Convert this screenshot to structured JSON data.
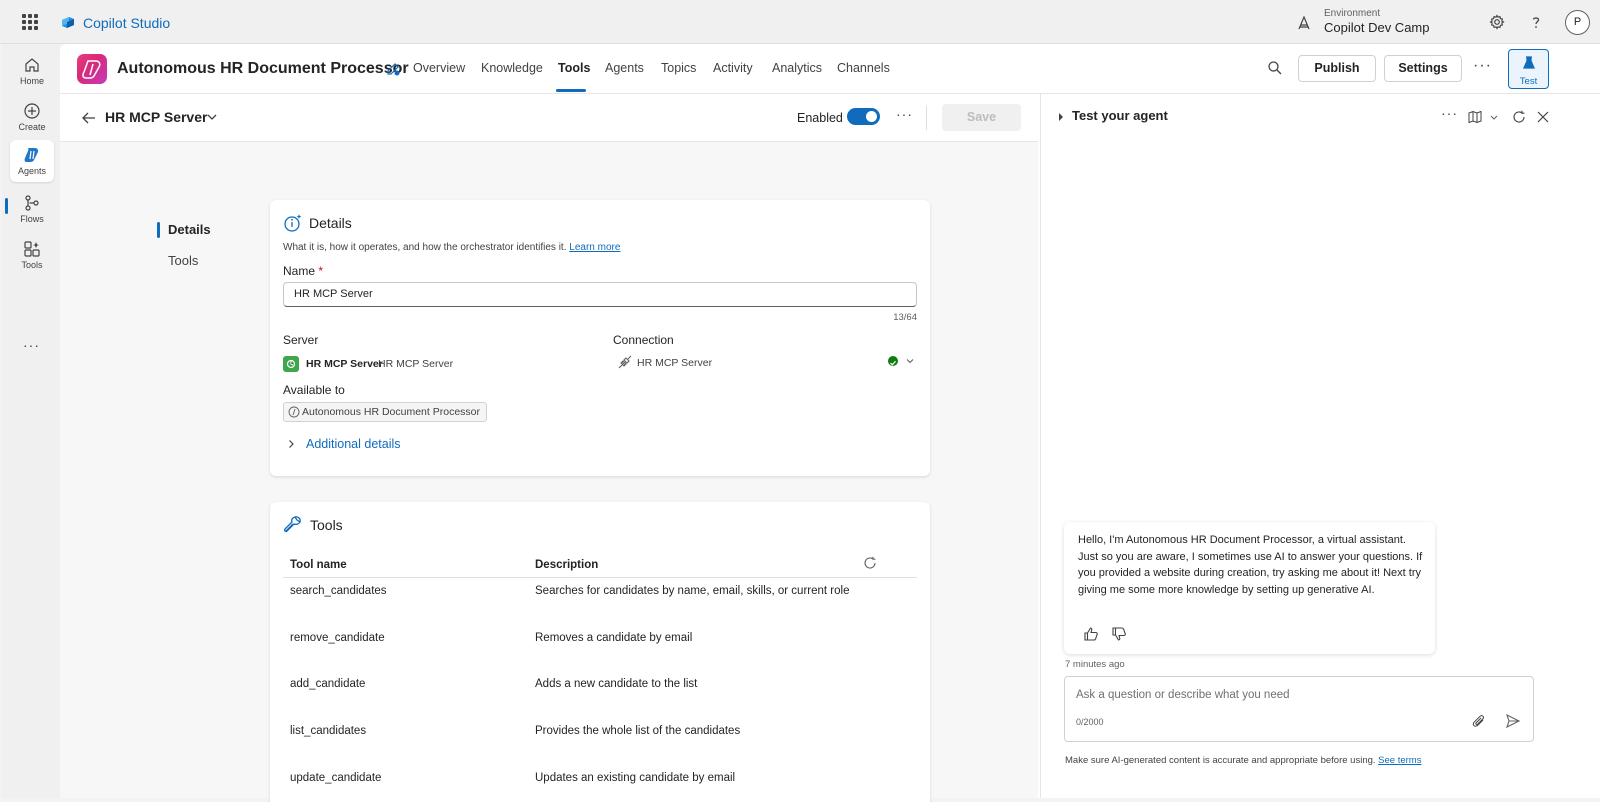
{
  "topbar": {
    "brand": "Copilot Studio",
    "environment_label": "Environment",
    "environment_value": "Copilot Dev Camp",
    "avatar_initial": "P"
  },
  "rail": {
    "items": [
      {
        "label": "Home",
        "icon": "home-icon"
      },
      {
        "label": "Create",
        "icon": "create-icon"
      },
      {
        "label": "Agents",
        "icon": "agents-icon"
      },
      {
        "label": "Flows",
        "icon": "flows-icon"
      },
      {
        "label": "Tools",
        "icon": "tools-icon"
      }
    ],
    "more": "···"
  },
  "agent": {
    "title": "Autonomous HR Document Processor",
    "tabs": [
      "Overview",
      "Knowledge",
      "Tools",
      "Agents",
      "Topics",
      "Activity",
      "Analytics",
      "Channels"
    ],
    "active_tab": "Tools",
    "publish_label": "Publish",
    "settings_label": "Settings",
    "more": "···",
    "test_label": "Test"
  },
  "subheader": {
    "title": "HR MCP Server",
    "enabled_label": "Enabled",
    "enabled": true,
    "more": "···",
    "save_label": "Save"
  },
  "sidenav": {
    "items": [
      "Details",
      "Tools"
    ],
    "active": "Details"
  },
  "details": {
    "title": "Details",
    "subtitle": "What it is, how it operates, and how the orchestrator identifies it.",
    "learn_more": "Learn more",
    "name_label": "Name",
    "required_mark": "*",
    "name_value": "HR MCP Server",
    "name_counter": "13/64",
    "server_label": "Server",
    "server_name": "HR MCP Server",
    "server_sub": "HR MCP Server",
    "connection_label": "Connection",
    "connection_name": "HR MCP Server",
    "connection_status_color": "#107c10",
    "available_label": "Available to",
    "available_value": "Autonomous HR Document Processor",
    "additional_details": "Additional details"
  },
  "tools": {
    "title": "Tools",
    "columns": [
      "Tool name",
      "Description"
    ],
    "rows": [
      {
        "name": "search_candidates",
        "description": "Searches for candidates by name, email, skills, or current role"
      },
      {
        "name": "remove_candidate",
        "description": "Removes a candidate by email"
      },
      {
        "name": "add_candidate",
        "description": "Adds a new candidate to the list"
      },
      {
        "name": "list_candidates",
        "description": "Provides the whole list of the candidates"
      },
      {
        "name": "update_candidate",
        "description": "Updates an existing candidate by email"
      }
    ]
  },
  "test_pane": {
    "title": "Test your agent",
    "more": "···",
    "message": "Hello, I'm Autonomous HR Document Processor, a virtual assistant. Just so you are aware, I sometimes use AI to answer your questions. If you provided a website during creation, try asking me about it! Next try giving me some more knowledge by setting up generative AI.",
    "timestamp": "7 minutes ago",
    "input_placeholder": "Ask a question or describe what you need",
    "input_counter": "0/2000",
    "disclaimer": "Make sure AI-generated content is accurate and appropriate before using.",
    "see_terms": "See terms"
  },
  "colors": {
    "accent": "#0f6cbd",
    "agent_icon": "#d9297a",
    "server_icon": "#3fa64b"
  }
}
